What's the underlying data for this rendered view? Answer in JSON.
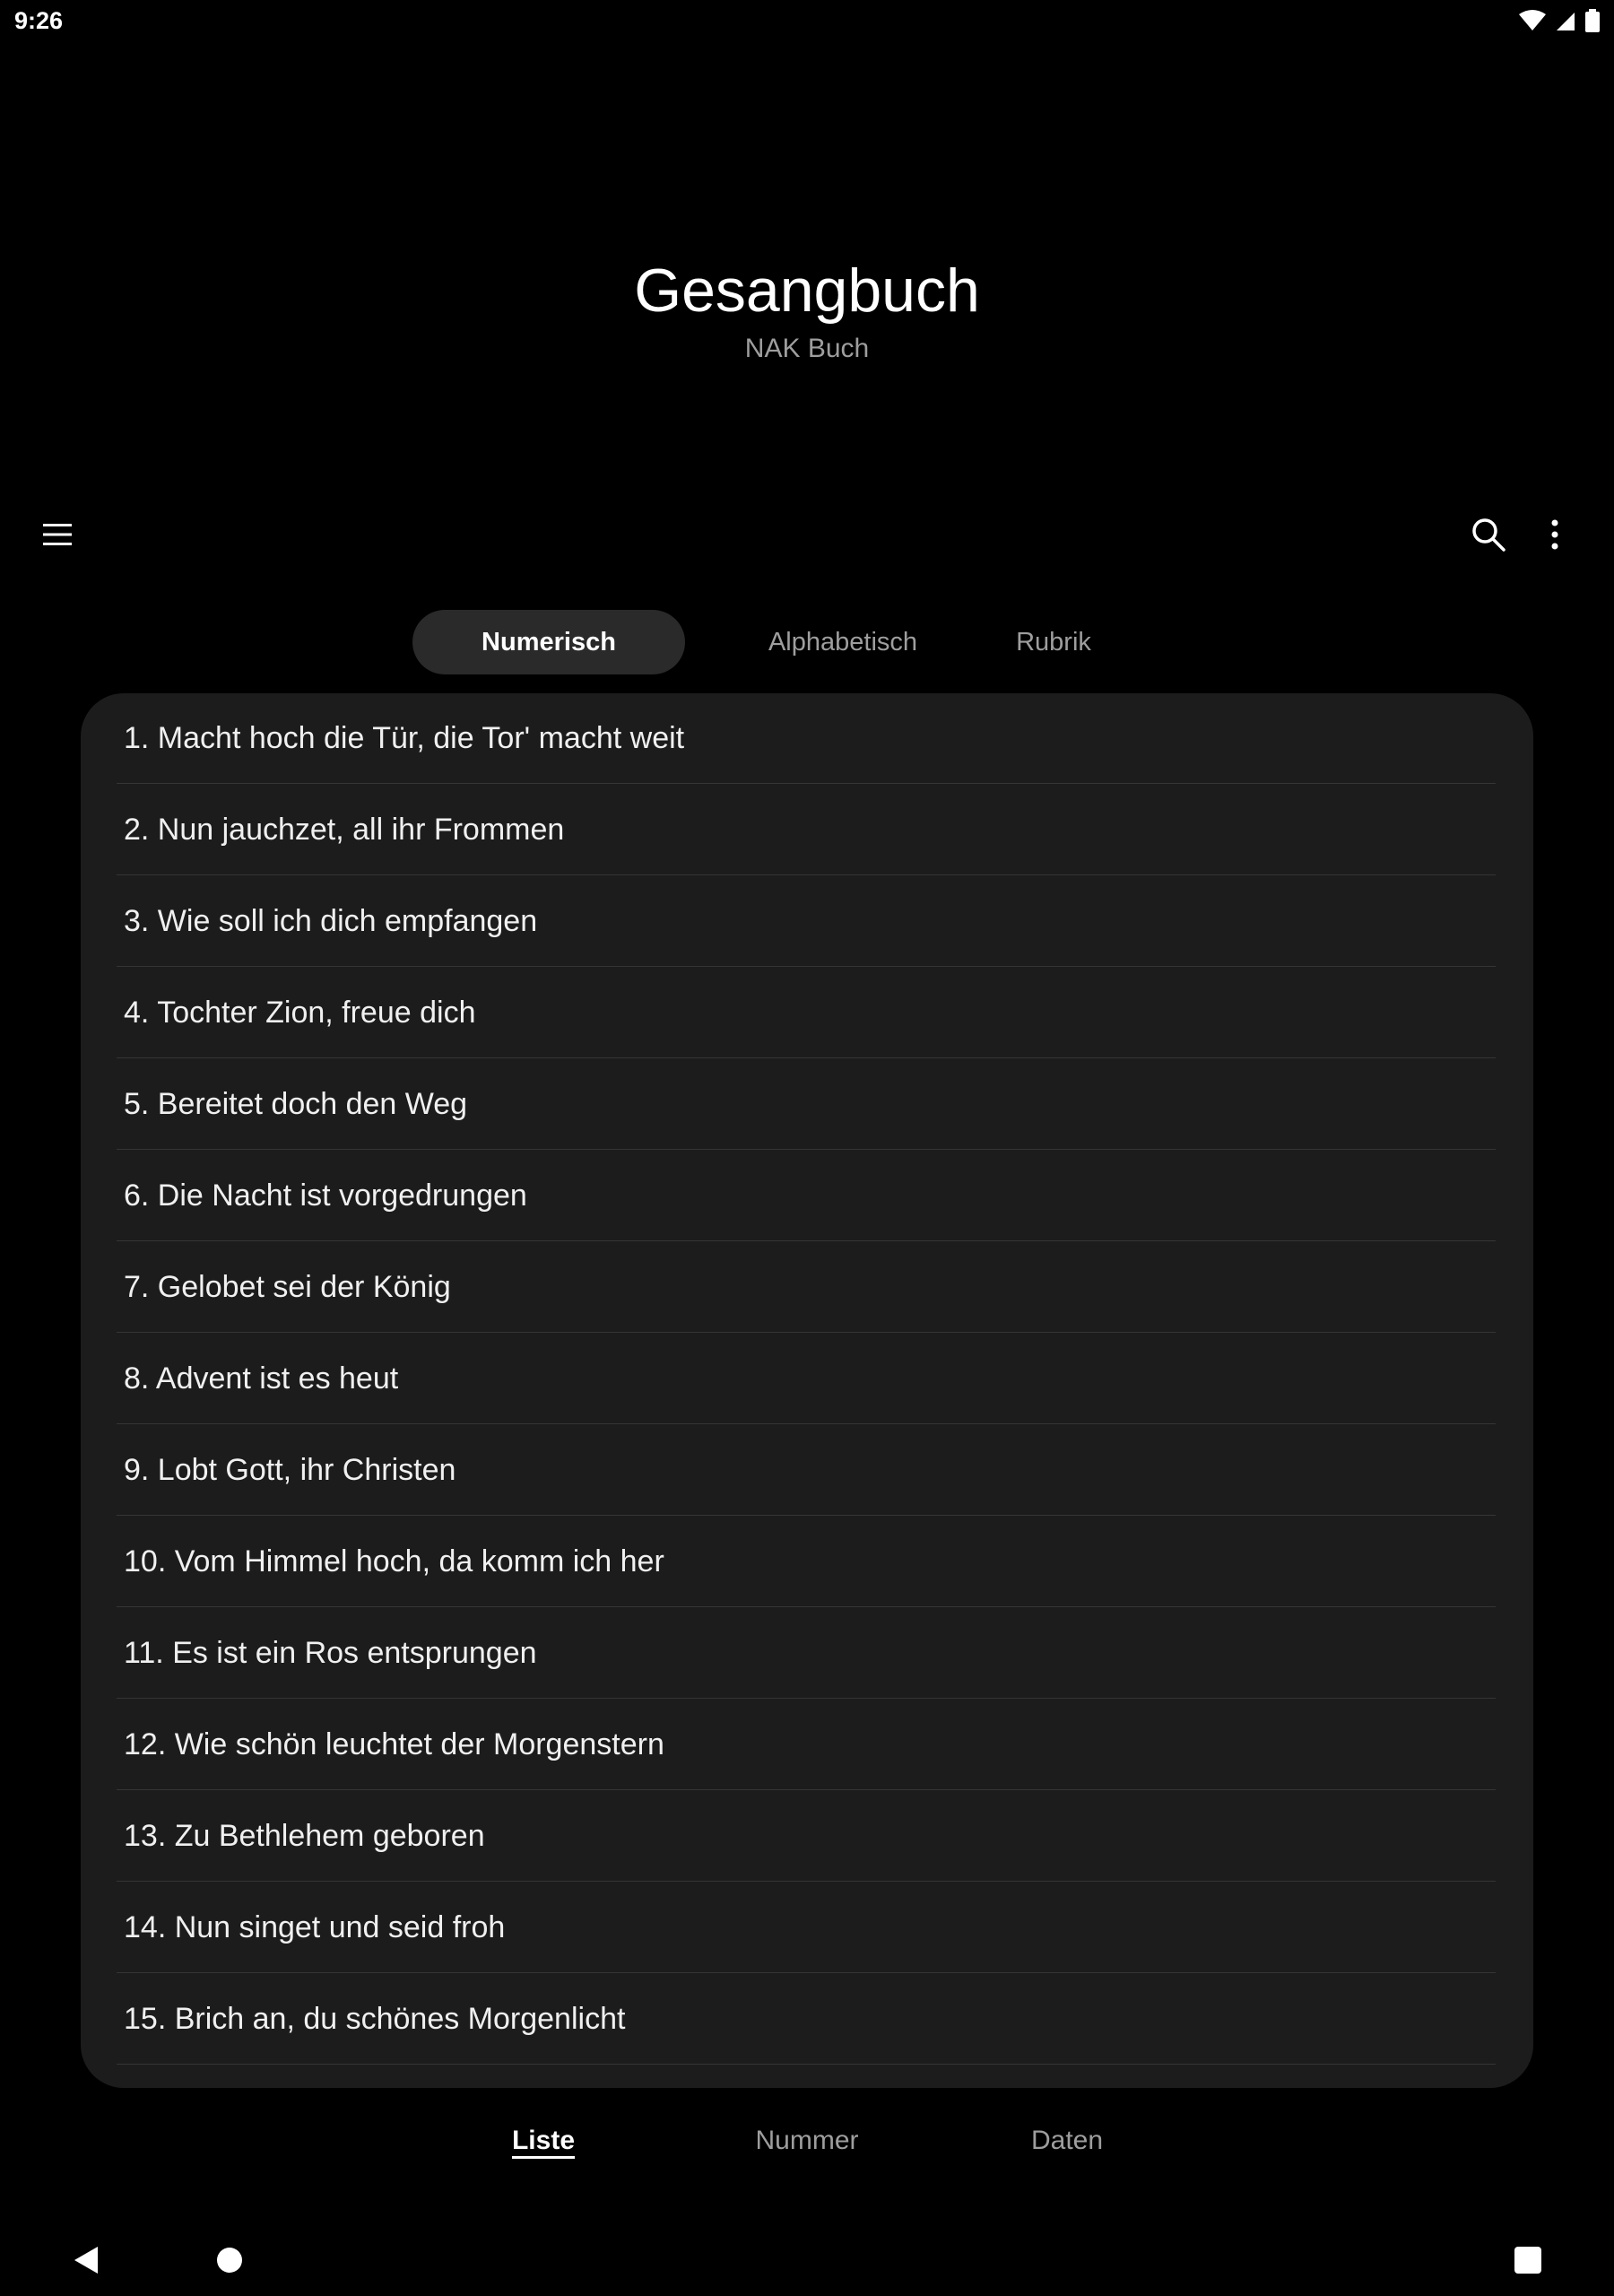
{
  "status_bar": {
    "time": "9:26"
  },
  "header": {
    "title": "Gesangbuch",
    "subtitle": "NAK Buch"
  },
  "toolbar": {
    "menu_icon": "hamburger-menu-icon",
    "search_icon": "search-icon",
    "more_icon": "more-vert-icon"
  },
  "tabs": [
    {
      "label": "Numerisch",
      "active": true
    },
    {
      "label": "Alphabetisch",
      "active": false
    },
    {
      "label": "Rubrik",
      "active": false
    }
  ],
  "songs": [
    "1. Macht hoch die Tür, die Tor' macht weit",
    "2. Nun jauchzet, all ihr Frommen",
    "3. Wie soll ich dich empfangen",
    "4. Tochter Zion, freue dich",
    "5. Bereitet doch den Weg",
    "6. Die Nacht ist vorgedrungen",
    "7. Gelobet sei der König",
    "8. Advent ist es heut",
    "9. Lobt Gott, ihr Christen",
    "10. Vom Himmel hoch, da komm ich her",
    "11. Es ist ein Ros entsprungen",
    "12. Wie schön leuchtet der Morgenstern",
    "13. Zu Bethlehem geboren",
    "14. Nun singet und seid froh",
    "15. Brich an, du schönes Morgenlicht"
  ],
  "bottom_nav": [
    {
      "label": "Liste",
      "active": true
    },
    {
      "label": "Nummer",
      "active": false
    },
    {
      "label": "Daten",
      "active": false
    }
  ],
  "colors": {
    "background": "#000000",
    "card": "#1c1c1c",
    "active_tab": "#2a2a2a",
    "muted_text": "#9e9e9e"
  }
}
